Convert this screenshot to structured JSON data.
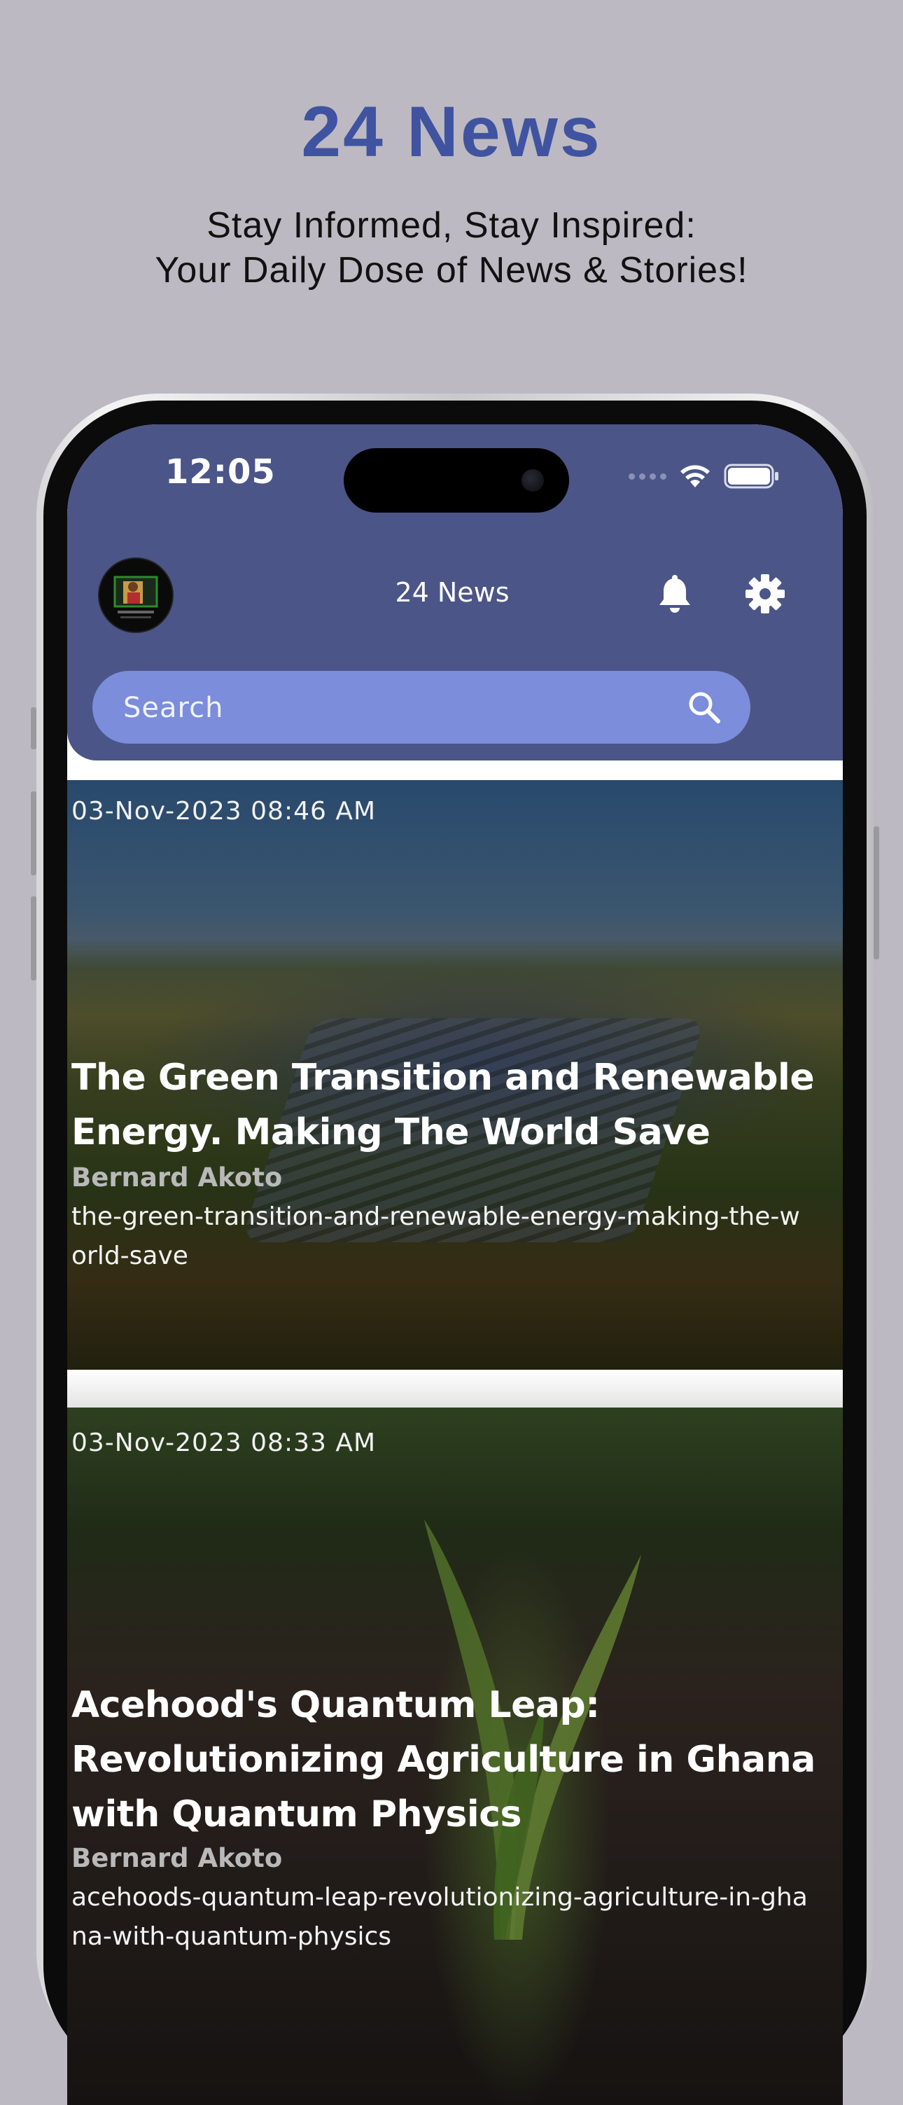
{
  "promo": {
    "title": "24 News",
    "subtitle_line1": "Stay Informed, Stay Inspired:",
    "subtitle_line2": "Your Daily Dose of News & Stories!"
  },
  "status_bar": {
    "time": "12:05"
  },
  "header": {
    "app_title": "24 News",
    "icons": [
      "avatar",
      "bell-icon",
      "gear-icon"
    ]
  },
  "search": {
    "placeholder": "Search",
    "icon": "search-icon"
  },
  "articles": [
    {
      "date": "03-Nov-2023  08:46 AM",
      "title": "The Green Transition and Renewable Energy. Making The World Save",
      "author": "Bernard Akoto",
      "slug": "the-green-transition-and-renewable-energy-making-the-world-save"
    },
    {
      "date": "03-Nov-2023  08:33 AM",
      "title": "Acehood's Quantum Leap: Revolutionizing Agriculture in Ghana with Quantum Physics",
      "author": "Bernard Akoto",
      "slug": "acehoods-quantum-leap-revolutionizing-agriculture-in-ghana-with-quantum-physics"
    }
  ],
  "colors": {
    "promo_title": "#3f53a0",
    "header": "#4b5588",
    "search_bar": "#7b8ddb",
    "background": "#bcb9c2"
  }
}
